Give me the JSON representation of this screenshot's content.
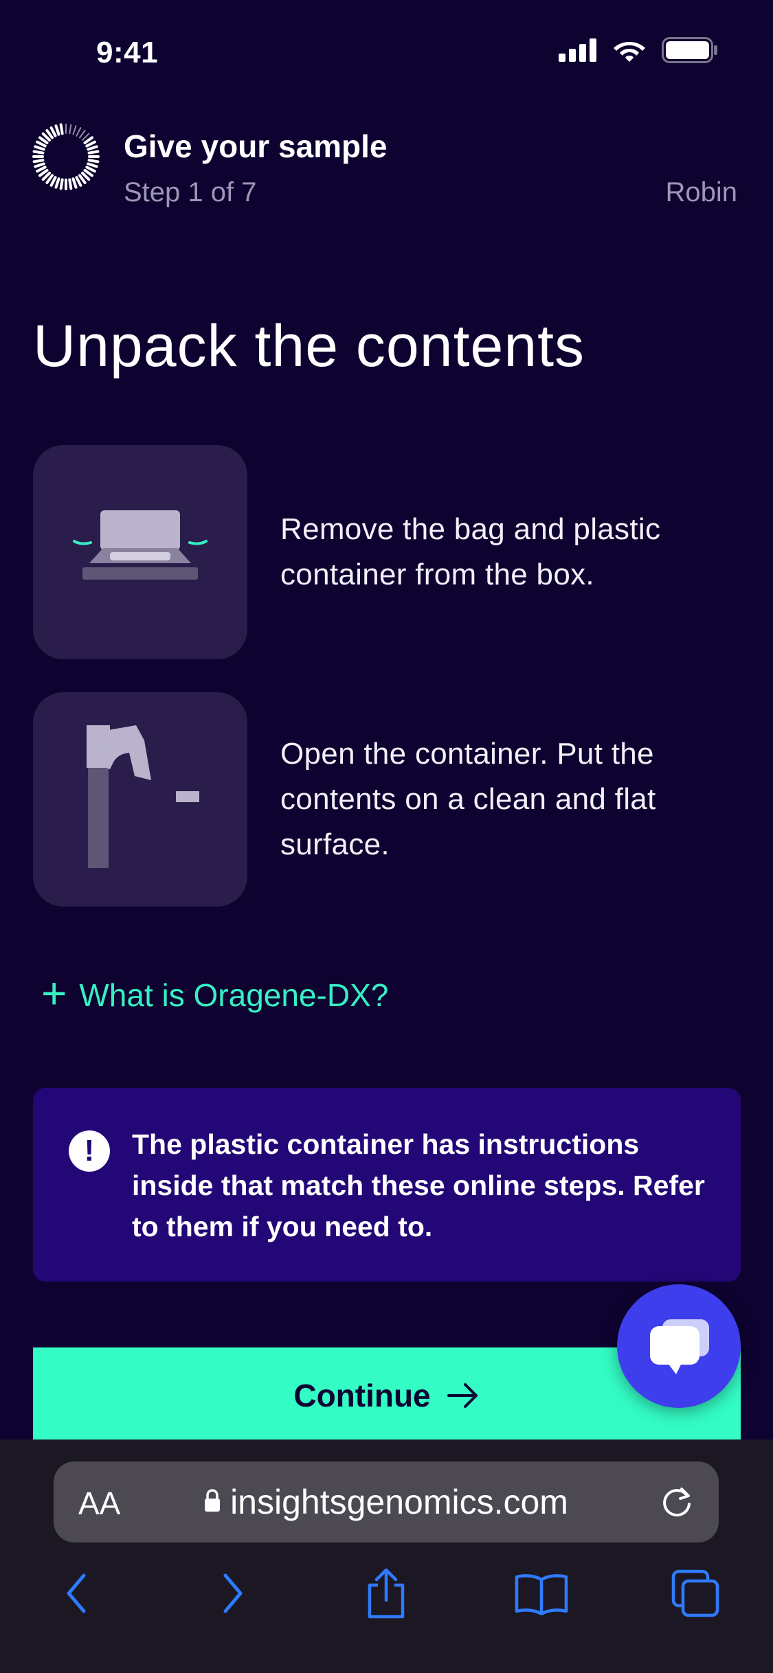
{
  "status_bar": {
    "time": "9:41"
  },
  "header": {
    "title": "Give your sample",
    "step": "Step 1 of 7",
    "user": "Robin",
    "progress": {
      "current": 1,
      "total": 7
    }
  },
  "main": {
    "heading": "Unpack the contents",
    "instructions": [
      {
        "text": "Remove the bag and plastic container from the box.",
        "illustration": "box-unpack-illustration"
      },
      {
        "text": "Open the container. Put the contents on a clean and flat surface.",
        "illustration": "kit-contents-illustration"
      }
    ],
    "expander_label": "What is Oragene-DX?",
    "callout": {
      "icon": "exclamation-icon",
      "text": "The plastic container has instructions inside that match these online steps. Refer to them if you need to."
    },
    "continue_label": "Continue"
  },
  "browser": {
    "text_size_label": "AA",
    "domain": "insightsgenomics.com"
  },
  "colors": {
    "background": "#0e0330",
    "accent": "#33fcc5",
    "callout": "#230777",
    "chat": "#3e3eec"
  }
}
